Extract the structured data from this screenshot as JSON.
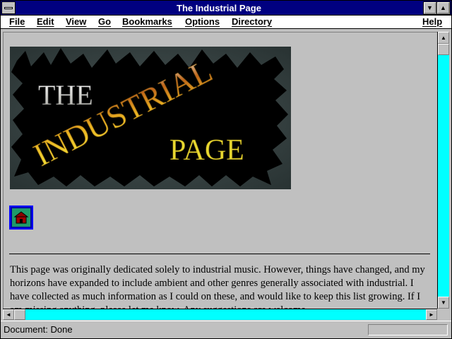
{
  "window": {
    "title": "The Industrial Page"
  },
  "menu": {
    "items": [
      "File",
      "Edit",
      "View",
      "Go",
      "Bookmarks",
      "Options",
      "Directory"
    ],
    "help": "Help"
  },
  "content": {
    "banner": {
      "line1": "THE",
      "line2": "INDUSTRIAL",
      "line3": "PAGE",
      "icon": "the-industrial-page-banner-image"
    },
    "home_icon": "home-icon",
    "paragraph": "This page was originally dedicated solely to industrial music. However, things have changed, and my horizons have expanded to include ambient and other genres generally associated with industrial. I have collected as much information as I could on these, and would like to keep this list growing. If I am missing anything, please let me know. Any suggestions are welcome."
  },
  "status": {
    "text": "Document: Done"
  },
  "colors": {
    "titlebar": "#000080",
    "scrollbar_track": "#00ffff",
    "chrome": "#c0c0c0"
  }
}
